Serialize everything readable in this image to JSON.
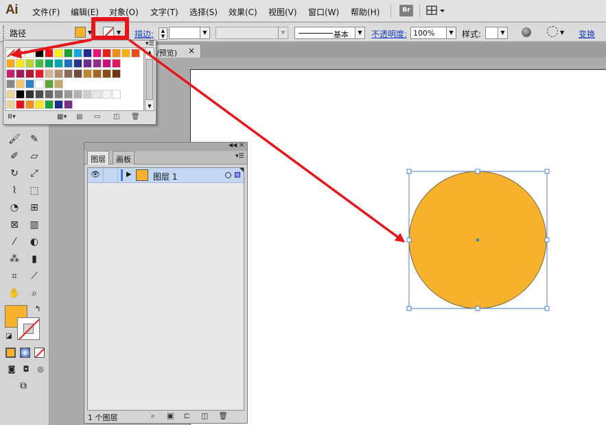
{
  "app": {
    "logo": "Ai"
  },
  "menu": [
    {
      "label": "文件(F)"
    },
    {
      "label": "编辑(E)"
    },
    {
      "label": "对象(O)"
    },
    {
      "label": "文字(T)"
    },
    {
      "label": "选择(S)"
    },
    {
      "label": "效果(C)"
    },
    {
      "label": "视图(V)"
    },
    {
      "label": "窗口(W)"
    },
    {
      "label": "帮助(H)"
    }
  ],
  "menubar_right": {
    "bridge_label": "Br"
  },
  "controlbar": {
    "selection_label": "路径",
    "fill_color": "#f6b22c",
    "stroke_label": "描边:",
    "brush_style_label": "基本",
    "opacity_label": "不透明度:",
    "opacity_value": "100%",
    "style_label": "样式:",
    "transform_label": "变换"
  },
  "document": {
    "tab_title": "/预览)",
    "close_symbol": "×"
  },
  "swatches": {
    "menu_icon": "panel-menu-icon",
    "rows": [
      [
        "#ffffff",
        "#000000",
        "#e4141b",
        "#f4ec1b",
        "#1d9f37",
        "#1aa7e1",
        "#1e2d8f",
        "#e5127c",
        "#e2221a",
        "#ef8f1c",
        "#f5b217",
        "#e94d1e"
      ],
      [
        "#f7a81b",
        "#f8e51c",
        "#b9d531",
        "#4db848",
        "#07a572",
        "#00a7a8",
        "#1b74b9",
        "#27358f",
        "#6c2c8c",
        "#8e2b8b",
        "#c8107b",
        "#e1175f"
      ],
      [
        "#c3216c",
        "#a21a5a",
        "#b0182d",
        "#e11d2f",
        "#d0b294",
        "#b08f72",
        "#8b6a56",
        "#6e4e3e",
        "#c1852a",
        "#a4651f",
        "#8c4a18",
        "#6d3712"
      ],
      [
        "#888888",
        "#f3c66a",
        "#2c7fc2",
        "#ffffff",
        "#5aa63b",
        "#c9a86b"
      ],
      [
        "#000000",
        "#333333",
        "#4d4d4d",
        "#666666",
        "#808080",
        "#999999",
        "#b3b3b3",
        "#cccccc",
        "#e6e6e6",
        "#f2f2f2",
        "#ffffff"
      ],
      [
        "#e4141b",
        "#ef8f1c",
        "#f8e51c",
        "#1d9f37",
        "#1e2d8f",
        "#7b2c8c"
      ]
    ]
  },
  "toolbar": {
    "fill_color": "#f6b22c",
    "tools": [
      "paintbrush",
      "pencil",
      "blob-brush",
      "eraser",
      "rotate",
      "scale",
      "warp",
      "free-transform",
      "shape-builder",
      "perspective-grid",
      "mesh",
      "gradient",
      "eyedropper",
      "blend",
      "symbol-sprayer",
      "column-graph",
      "artboard",
      "slice",
      "hand",
      "zoom"
    ]
  },
  "layers_panel": {
    "tabs": [
      {
        "label": "图层"
      },
      {
        "label": "画板"
      }
    ],
    "layers": [
      {
        "name": "图层 1",
        "color": "#4b74d7",
        "thumb_color": "#f6b22c"
      }
    ],
    "footer_count": "1 个图层"
  },
  "artwork": {
    "circle_fill": "#f6b22c",
    "circle_stroke": "#7b6a44",
    "selection_color": "#4a7fcf"
  },
  "annotation": {
    "color": "#e8141a"
  }
}
